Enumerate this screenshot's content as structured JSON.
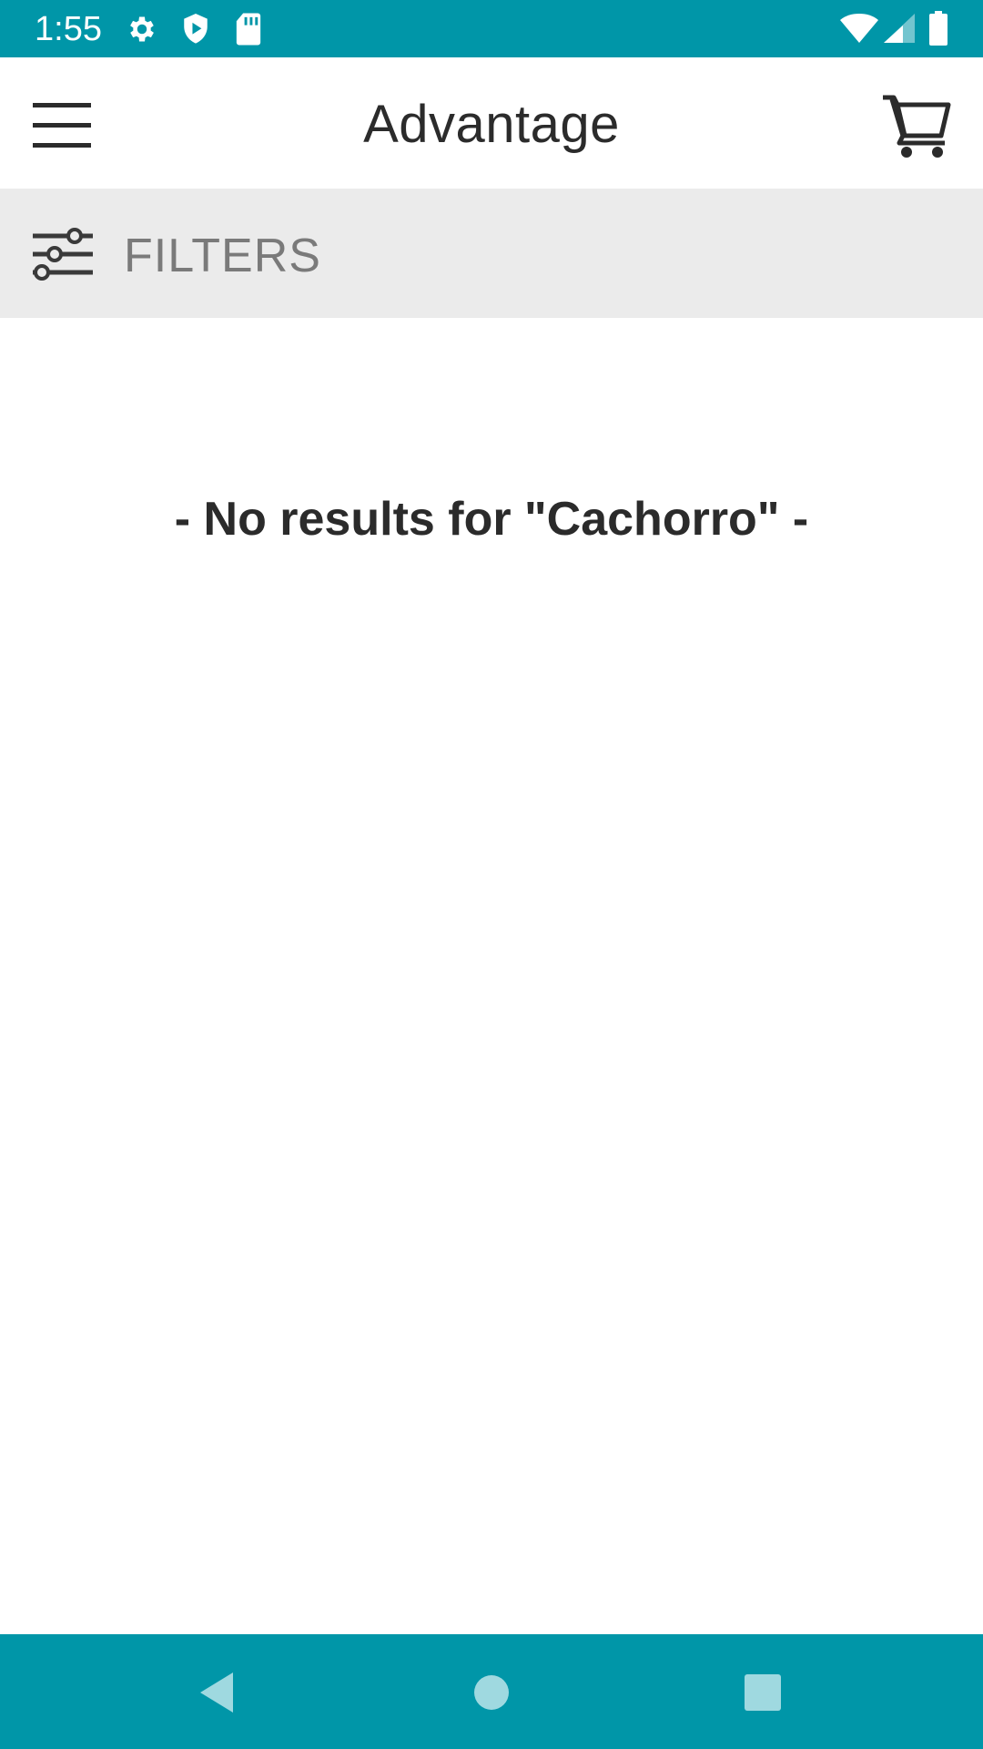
{
  "status_bar": {
    "time": "1:55",
    "left_icons": [
      "settings-icon",
      "shield-play-icon",
      "sd-card-icon"
    ],
    "right_icons": [
      "wifi-icon",
      "cell-signal-icon",
      "battery-icon"
    ],
    "background": "#0096a8"
  },
  "app_bar": {
    "title": "Advantage",
    "menu_icon": "hamburger-menu-icon",
    "cart_icon": "shopping-cart-icon"
  },
  "filters": {
    "label": "FILTERS",
    "icon": "sliders-icon",
    "background": "#ebebeb"
  },
  "results": {
    "message": "- No results for \"Cachorro\" -"
  },
  "nav_bar": {
    "buttons": [
      "back-icon",
      "home-icon",
      "recents-icon"
    ],
    "background": "#0096a8"
  }
}
